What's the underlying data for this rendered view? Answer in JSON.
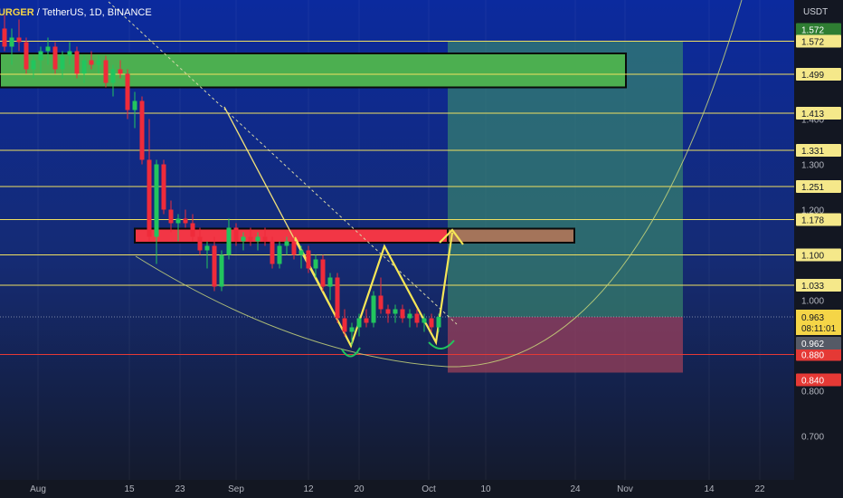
{
  "header": {
    "symbol": "BURGER",
    "pair_text": " / TetherUS, 1D, BINANCE"
  },
  "chart_data": {
    "type": "candlestick",
    "symbol": "BURGER / TetherUS",
    "interval": "1D",
    "exchange": "BINANCE",
    "currency": "USDT",
    "ylim": [
      0.67,
      1.63
    ],
    "x_labels": [
      "Aug",
      "15",
      "23",
      "Sep",
      "12",
      "20",
      "Oct",
      "10",
      "24",
      "Nov",
      "14",
      "22"
    ],
    "y_ticks": [
      "1.400",
      "1.300",
      "1.200",
      "1.000",
      "0.800",
      "0.700"
    ],
    "levels": [
      {
        "value": "1.572",
        "color": "#f0e060"
      },
      {
        "value": "1.499",
        "color": "#f0e060"
      },
      {
        "value": "1.413",
        "color": "#f0e060"
      },
      {
        "value": "1.331",
        "color": "#f0e060"
      },
      {
        "value": "1.251",
        "color": "#f0e060"
      },
      {
        "value": "1.178",
        "color": "#f0e060"
      },
      {
        "value": "1.100",
        "color": "#f0e060"
      },
      {
        "value": "1.033",
        "color": "#f0e060"
      },
      {
        "value": "0.880",
        "color": "#e53935"
      }
    ],
    "top_badge": {
      "value": "1.572",
      "color": "#2e7d32"
    },
    "price_badge": {
      "value": "0.963",
      "timer": "08:11:01",
      "color": "#f5d547"
    },
    "bid_badge": {
      "value": "0.962",
      "color": "#555a66"
    },
    "stop_badge": {
      "value": "0.840",
      "color": "#e53935"
    },
    "zones": [
      {
        "name": "supply-zone",
        "y_top": 1.545,
        "y_bottom": 1.47,
        "color": "#4caf50"
      },
      {
        "name": "resistance-zone",
        "y_top": 1.158,
        "y_bottom": 1.127,
        "color": "#f23645"
      }
    ],
    "position": {
      "entry": 0.963,
      "target": 1.572,
      "stop": 0.84
    },
    "candles_approx": [
      [
        1.6,
        1.63,
        1.55,
        1.56
      ],
      [
        1.56,
        1.6,
        1.52,
        1.58
      ],
      [
        1.58,
        1.62,
        1.55,
        1.57
      ],
      [
        1.57,
        1.58,
        1.5,
        1.51
      ],
      [
        1.51,
        1.54,
        1.49,
        1.53
      ],
      [
        1.53,
        1.56,
        1.5,
        1.55
      ],
      [
        1.55,
        1.58,
        1.52,
        1.56
      ],
      [
        1.56,
        1.57,
        1.5,
        1.51
      ],
      [
        1.51,
        1.55,
        1.49,
        1.54
      ],
      [
        1.54,
        1.57,
        1.52,
        1.55
      ],
      [
        1.55,
        1.56,
        1.49,
        1.5
      ],
      [
        1.5,
        1.54,
        1.48,
        1.53
      ],
      [
        1.53,
        1.55,
        1.51,
        1.52
      ],
      [
        1.52,
        1.54,
        1.5,
        1.53
      ],
      [
        1.53,
        1.54,
        1.47,
        1.48
      ],
      [
        1.48,
        1.52,
        1.45,
        1.51
      ],
      [
        1.51,
        1.53,
        1.49,
        1.5
      ],
      [
        1.5,
        1.51,
        1.4,
        1.42
      ],
      [
        1.42,
        1.46,
        1.38,
        1.44
      ],
      [
        1.44,
        1.45,
        1.3,
        1.31
      ],
      [
        1.31,
        1.4,
        1.13,
        1.14
      ],
      [
        1.14,
        1.31,
        1.08,
        1.3
      ],
      [
        1.3,
        1.31,
        1.19,
        1.2
      ],
      [
        1.2,
        1.22,
        1.15,
        1.17
      ],
      [
        1.17,
        1.19,
        1.13,
        1.18
      ],
      [
        1.18,
        1.2,
        1.16,
        1.17
      ],
      [
        1.17,
        1.19,
        1.13,
        1.14
      ],
      [
        1.14,
        1.16,
        1.1,
        1.11
      ],
      [
        1.11,
        1.13,
        1.07,
        1.12
      ],
      [
        1.12,
        1.14,
        1.02,
        1.03
      ],
      [
        1.03,
        1.11,
        1.02,
        1.1
      ],
      [
        1.1,
        1.18,
        1.09,
        1.16
      ],
      [
        1.16,
        1.17,
        1.12,
        1.13
      ],
      [
        1.13,
        1.15,
        1.11,
        1.14
      ],
      [
        1.14,
        1.16,
        1.12,
        1.13
      ],
      [
        1.13,
        1.15,
        1.11,
        1.14
      ],
      [
        1.14,
        1.16,
        1.12,
        1.13
      ],
      [
        1.13,
        1.14,
        1.07,
        1.08
      ],
      [
        1.08,
        1.13,
        1.07,
        1.12
      ],
      [
        1.12,
        1.14,
        1.1,
        1.13
      ],
      [
        1.13,
        1.14,
        1.09,
        1.1
      ],
      [
        1.1,
        1.12,
        1.07,
        1.11
      ],
      [
        1.11,
        1.12,
        1.06,
        1.07
      ],
      [
        1.07,
        1.1,
        1.05,
        1.09
      ],
      [
        1.09,
        1.1,
        1.02,
        1.03
      ],
      [
        1.03,
        1.06,
        1.0,
        1.05
      ],
      [
        1.05,
        1.06,
        0.95,
        0.96
      ],
      [
        0.96,
        0.98,
        0.92,
        0.93
      ],
      [
        0.93,
        0.95,
        0.9,
        0.94
      ],
      [
        0.94,
        0.97,
        0.92,
        0.96
      ],
      [
        0.96,
        0.98,
        0.94,
        0.95
      ],
      [
        0.95,
        1.02,
        0.94,
        1.01
      ],
      [
        1.01,
        1.05,
        0.97,
        0.98
      ],
      [
        0.98,
        0.99,
        0.95,
        0.97
      ],
      [
        0.97,
        0.99,
        0.95,
        0.98
      ],
      [
        0.98,
        0.99,
        0.95,
        0.96
      ],
      [
        0.96,
        0.98,
        0.94,
        0.97
      ],
      [
        0.97,
        0.98,
        0.94,
        0.95
      ],
      [
        0.95,
        0.97,
        0.93,
        0.96
      ],
      [
        0.96,
        0.97,
        0.93,
        0.94
      ],
      [
        0.94,
        0.97,
        0.93,
        0.963
      ]
    ]
  }
}
